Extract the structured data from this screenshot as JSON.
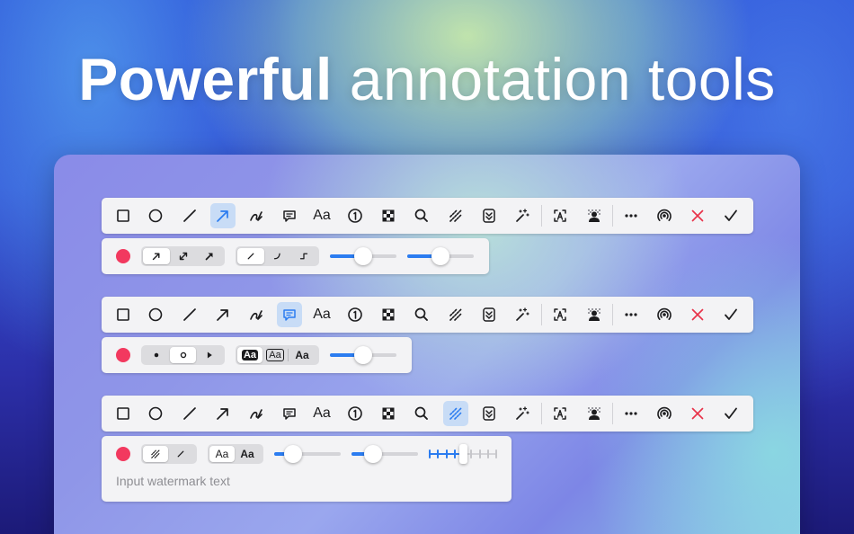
{
  "headline": {
    "bold": "Powerful",
    "light": "annotation tools"
  },
  "colors": {
    "accent": "#2b7cf0",
    "record": "#f2395f",
    "close": "#e8334a",
    "active_bg": "#c8dcf6"
  },
  "tool_icons": [
    "rectangle-icon",
    "ellipse-icon",
    "line-icon",
    "arrow-icon",
    "pen-icon",
    "speech-bubble-icon",
    "text-icon",
    "counter-icon",
    "pixelate-icon",
    "magnifier-icon",
    "watermark-icon",
    "highlight-icon",
    "magic-wand-icon",
    "ocr-icon",
    "background-remove-icon",
    "more-icon",
    "airdrop-icon",
    "close-icon",
    "check-icon"
  ],
  "toolbars": [
    {
      "text_label": "Aa",
      "counter_label": "1",
      "active_tool": "arrow"
    },
    {
      "text_label": "Aa",
      "counter_label": "1",
      "active_tool": "speech-bubble"
    },
    {
      "text_label": "Aa",
      "counter_label": "1",
      "active_tool": "watermark"
    }
  ],
  "arrow_props": {
    "arrow_styles": [
      "single-arrow-icon",
      "double-arrow-icon",
      "filled-arrow-icon"
    ],
    "selected_arrow_style": 0,
    "line_styles": [
      "straight-line-icon",
      "curved-line-icon",
      "elbow-line-icon"
    ],
    "selected_line_style": 0,
    "slider1_value": 0.5,
    "slider2_value": 0.5
  },
  "bubble_props": {
    "tail_styles": [
      "dot-icon",
      "ring-icon",
      "triangle-icon"
    ],
    "selected_tail_style": 1,
    "text_styles": [
      "Aa",
      "Aa",
      "Aa"
    ],
    "selected_text_style": 0,
    "slider_value": 0.5
  },
  "watermark_props": {
    "pattern_styles": [
      "hatch-icon",
      "slash-icon"
    ],
    "selected_pattern_style": 0,
    "text_styles": [
      "Aa",
      "Aa"
    ],
    "selected_text_style": 0,
    "slider1_value": 0.2,
    "slider2_value": 0.25,
    "tick_slider_value": 0.5,
    "input_placeholder": "Input watermark text"
  }
}
